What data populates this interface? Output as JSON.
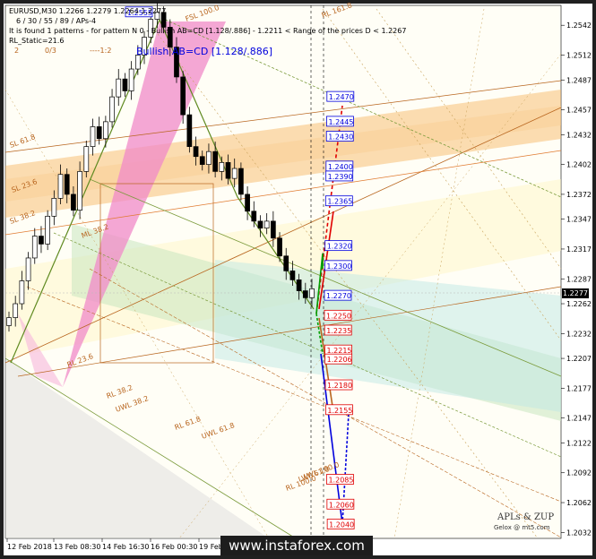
{
  "header": {
    "symbol_line": "EURUSD,M30  1.2266 1.2279 1.2264 1.2277",
    "params_line": "6 / 30 / 55 / 89 / APs-4",
    "pattern_line": "It is found 1 patterns  -  for pattern N 0 - Bullish AB=CD [1.128/.886] - 1.2211 < Range of the prices D < 1.2267",
    "static_line": "RL_Static=21.6",
    "nums_line": [
      "2",
      "0/3",
      "----1:2"
    ]
  },
  "pattern_title": "Bullish AB=CD [1.128/.886]",
  "colors": {
    "pink": "#f08ac8",
    "orange_band": "#f6b35a",
    "green_band": "#c9e6c0",
    "teal_band": "#bfe8e4",
    "red": "#e00000",
    "green": "#00a000",
    "blue": "#0000dd",
    "olive": "#7a9a3a",
    "brown": "#b8651e"
  },
  "chart_data": {
    "type": "candlestick",
    "symbol": "EURUSD",
    "timeframe": "M30",
    "ylim": [
      1.2026,
      1.2562
    ],
    "y_ticks": [
      1.2542,
      1.2512,
      1.2487,
      1.2457,
      1.2432,
      1.2402,
      1.2372,
      1.2347,
      1.2317,
      1.2287,
      1.2262,
      1.2232,
      1.2207,
      1.2177,
      1.2147,
      1.2122,
      1.2092,
      1.2062,
      1.2032
    ],
    "x_ticks": [
      "12 Feb 2018",
      "13 Feb 08:30",
      "14 Feb 16:30",
      "16 Feb 00:30",
      "19 Feb"
    ],
    "current_price": "1.2277",
    "close_series": [
      1.2248,
      1.2262,
      1.2285,
      1.2308,
      1.233,
      1.2322,
      1.235,
      1.2368,
      1.2392,
      1.2372,
      1.2356,
      1.2395,
      1.242,
      1.244,
      1.2428,
      1.2445,
      1.247,
      1.2488,
      1.2476,
      1.2498,
      1.2512,
      1.253,
      1.2548,
      1.2555,
      1.254,
      1.252,
      1.249,
      1.2452,
      1.242,
      1.241,
      1.2402,
      1.2415,
      1.2395,
      1.2404,
      1.2388,
      1.2398,
      1.2372,
      1.2355,
      1.2345,
      1.2338,
      1.2345,
      1.2328,
      1.231,
      1.2295,
      1.2286,
      1.2275,
      1.2268,
      1.2277
    ],
    "price_labels": [
      {
        "text": "1.2555",
        "value": 1.2555,
        "color": "#0000dd"
      },
      {
        "text": "1.2470",
        "value": 1.247,
        "color": "#0000dd"
      },
      {
        "text": "1.2445",
        "value": 1.2445,
        "color": "#0000dd"
      },
      {
        "text": "1.2430",
        "value": 1.243,
        "color": "#0000dd"
      },
      {
        "text": "1.2400",
        "value": 1.24,
        "color": "#0000dd"
      },
      {
        "text": "1.2390",
        "value": 1.239,
        "color": "#0000dd"
      },
      {
        "text": "1.2365",
        "value": 1.2365,
        "color": "#0000dd"
      },
      {
        "text": "1.2320",
        "value": 1.232,
        "color": "#0000dd"
      },
      {
        "text": "1.2300",
        "value": 1.23,
        "color": "#0000dd"
      },
      {
        "text": "1.2270",
        "value": 1.227,
        "color": "#0000dd"
      },
      {
        "text": "1.2250",
        "value": 1.225,
        "color": "#e00000"
      },
      {
        "text": "1.2235",
        "value": 1.2235,
        "color": "#e00000"
      },
      {
        "text": "1.2215",
        "value": 1.2215,
        "color": "#e00000"
      },
      {
        "text": "1.2206",
        "value": 1.2206,
        "color": "#e00000"
      },
      {
        "text": "1.2180",
        "value": 1.218,
        "color": "#e00000"
      },
      {
        "text": "1.2155",
        "value": 1.2155,
        "color": "#e00000"
      },
      {
        "text": "1.2085",
        "value": 1.2085,
        "color": "#e00000"
      },
      {
        "text": "1.2060",
        "value": 1.206,
        "color": "#e00000"
      },
      {
        "text": "1.2040",
        "value": 1.204,
        "color": "#e00000"
      }
    ],
    "line_labels": [
      "SL 61.8",
      "SL 38.2",
      "SL 23.6",
      "RL 23.6",
      "RL 38.2",
      "RL 61.8",
      "UWL 38.2",
      "UWL 61.8",
      "LWL 61.8",
      "LWL 100.0",
      "RL 100.0",
      "RL 161.8",
      "FSL 100.0",
      "ML 38.2"
    ]
  },
  "watermark": "www.instaforex.com",
  "brand": {
    "name": "APLs & ZUP",
    "email": "Gelox @ mt5.com"
  }
}
